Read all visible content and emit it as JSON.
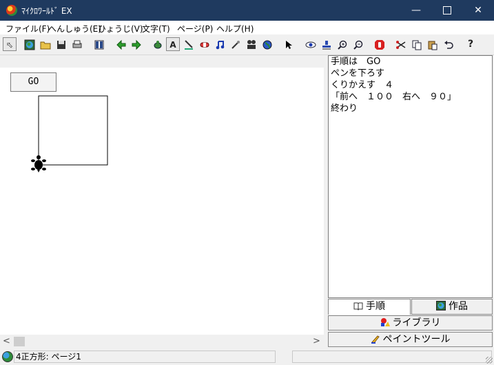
{
  "window": {
    "title": "ﾏｲｸﾛﾜｰﾙﾄﾞ EX",
    "minimize": "—",
    "close": "✕"
  },
  "menu": [
    {
      "label": "ファイル(F)"
    },
    {
      "label": "へんしゅう(E)"
    },
    {
      "label": "ひょうじ(V)"
    },
    {
      "label": "文字(T)"
    },
    {
      "label": "ページ(P)"
    },
    {
      "label": "ヘルプ(H)"
    }
  ],
  "toolbar": {
    "icons": [
      "pointer-mode-icon",
      "globe-icon",
      "open-folder-icon",
      "save-disk-icon",
      "print-icon",
      "frame-icon",
      "back-arrow-icon",
      "forward-arrow-icon",
      "turtle-icon",
      "text-box-icon",
      "pen-tool-icon",
      "eraser-icon",
      "music-note-icon",
      "magic-wand-icon",
      "film-projector-icon",
      "world-globe-icon",
      "arrow-cursor-icon",
      "eye-icon",
      "stamp-icon",
      "zoom-in-icon",
      "zoom-out-icon",
      "stop-hand-icon",
      "scissors-icon",
      "copy-icon",
      "paste-icon",
      "undo-icon",
      "help-icon"
    ],
    "text_box_label": "A",
    "help_label": "?"
  },
  "canvas": {
    "go_button": "GO",
    "pen_color": "#000000",
    "turtle_color": "#000000"
  },
  "scroll": {
    "left": "<",
    "right": ">"
  },
  "procedure": {
    "lines": [
      "手順は　GO",
      "ペンを下ろす",
      "くりかえす　４",
      "「前へ　１００　右へ　９０」",
      "終わり"
    ]
  },
  "tabs": {
    "procedure": "手順",
    "works": "作品",
    "library": "ライブラリ",
    "paint_tool": "ペイントツール"
  },
  "status": {
    "text": "4正方形: ページ1"
  }
}
